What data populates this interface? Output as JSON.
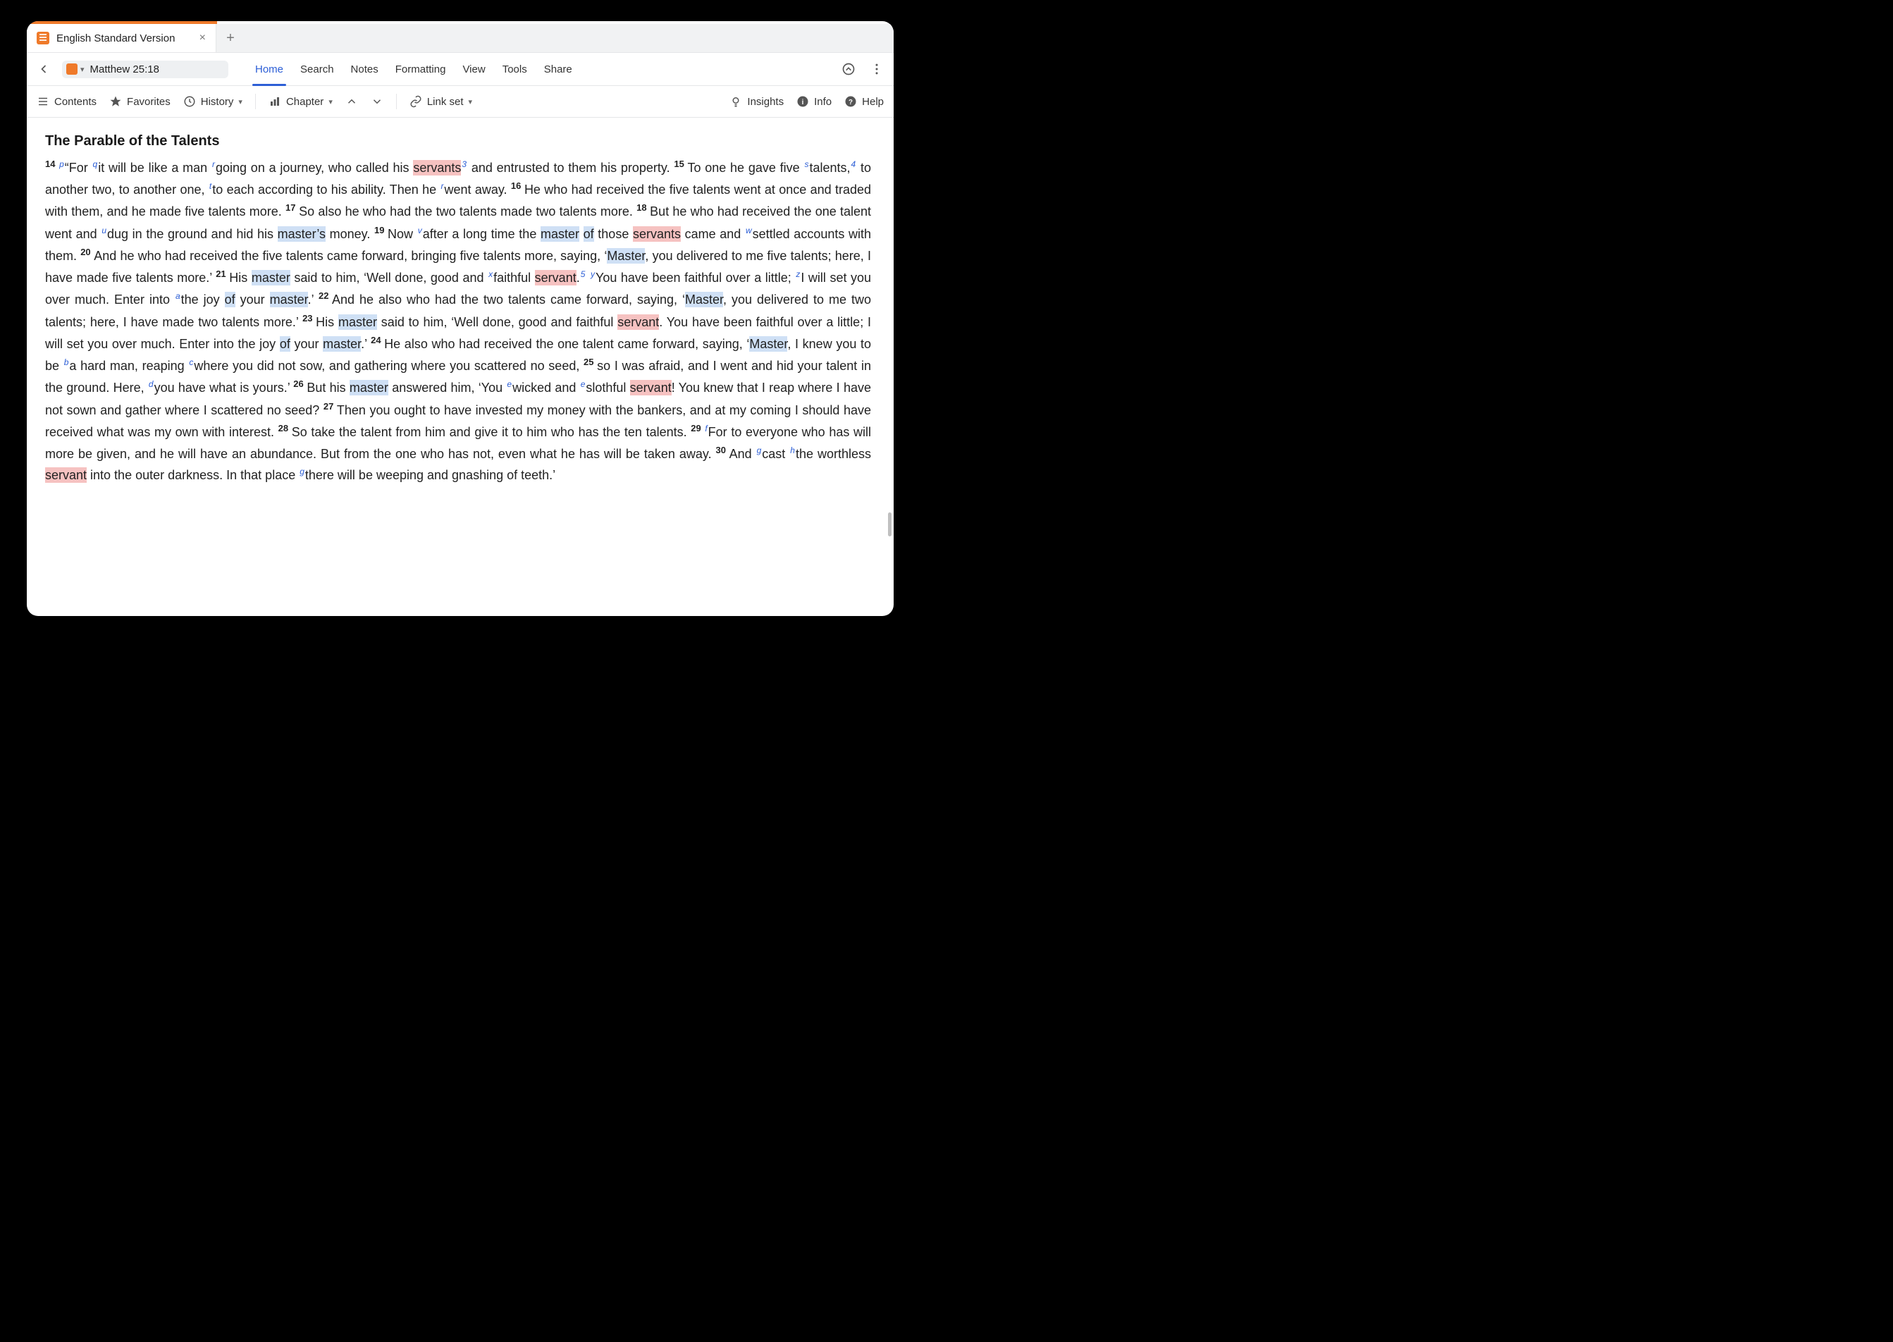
{
  "tab": {
    "title": "English Standard Version"
  },
  "location": {
    "reference": "Matthew 25:18"
  },
  "menu": {
    "home": "Home",
    "search": "Search",
    "notes": "Notes",
    "formatting": "Formatting",
    "view": "View",
    "tools": "Tools",
    "share": "Share"
  },
  "toolbar": {
    "contents": "Contents",
    "favorites": "Favorites",
    "history": "History",
    "chapter": "Chapter",
    "linkset": "Link set",
    "insights": "Insights",
    "info": "Info",
    "help": "Help"
  },
  "section_title": "The Parable of the Talents",
  "verses": [
    {
      "n": "14",
      "parts": [
        {
          "t": "xnote",
          "v": "p"
        },
        {
          "t": "text",
          "v": "“For "
        },
        {
          "t": "xnote",
          "v": "q"
        },
        {
          "t": "text",
          "v": "it will be like a man "
        },
        {
          "t": "xnote",
          "v": "r"
        },
        {
          "t": "text",
          "v": "going on a journey, who called his "
        },
        {
          "t": "hl-p",
          "v": "servants"
        },
        {
          "t": "fnote",
          "v": "3"
        },
        {
          "t": "text",
          "v": " and entrusted to them his property. "
        }
      ]
    },
    {
      "n": "15",
      "parts": [
        {
          "t": "text",
          "v": "To one he gave five "
        },
        {
          "t": "xnote",
          "v": "s"
        },
        {
          "t": "text",
          "v": "talents,"
        },
        {
          "t": "fnote",
          "v": "4"
        },
        {
          "t": "text",
          "v": " to another two, to another one, "
        },
        {
          "t": "xnote",
          "v": "t"
        },
        {
          "t": "text",
          "v": "to each according to his ability. Then he "
        },
        {
          "t": "xnote",
          "v": "r"
        },
        {
          "t": "text",
          "v": "went away. "
        }
      ]
    },
    {
      "n": "16",
      "parts": [
        {
          "t": "text",
          "v": "He who had received the five talents went at once and traded with them, and he made five talents more. "
        }
      ]
    },
    {
      "n": "17",
      "parts": [
        {
          "t": "text",
          "v": "So also he who had the two talents made two talents more. "
        }
      ]
    },
    {
      "n": "18",
      "parts": [
        {
          "t": "text",
          "v": "But he who had received the one talent went and "
        },
        {
          "t": "xnote",
          "v": "u"
        },
        {
          "t": "text",
          "v": "dug in the ground and hid his "
        },
        {
          "t": "hl-b",
          "v": "master’s"
        },
        {
          "t": "text",
          "v": " money. "
        }
      ]
    },
    {
      "n": "19",
      "parts": [
        {
          "t": "text",
          "v": "Now "
        },
        {
          "t": "xnote",
          "v": "v"
        },
        {
          "t": "text",
          "v": "after a long time the "
        },
        {
          "t": "hl-b",
          "v": "master"
        },
        {
          "t": "text",
          "v": " "
        },
        {
          "t": "hl-b",
          "v": "of"
        },
        {
          "t": "text",
          "v": " those "
        },
        {
          "t": "hl-p",
          "v": "servants"
        },
        {
          "t": "text",
          "v": " came and "
        },
        {
          "t": "xnote",
          "v": "w"
        },
        {
          "t": "text",
          "v": "settled accounts with them. "
        }
      ]
    },
    {
      "n": "20",
      "parts": [
        {
          "t": "text",
          "v": "And he who had received the five talents came forward, bringing five talents more, saying, ‘"
        },
        {
          "t": "hl-b",
          "v": "Master"
        },
        {
          "t": "text",
          "v": ", you delivered to me five talents; here, I have made five talents more.’ "
        }
      ]
    },
    {
      "n": "21",
      "parts": [
        {
          "t": "text",
          "v": "His "
        },
        {
          "t": "hl-b",
          "v": "master"
        },
        {
          "t": "text",
          "v": " said to him, ‘Well done, good and "
        },
        {
          "t": "xnote",
          "v": "x"
        },
        {
          "t": "text",
          "v": "faithful "
        },
        {
          "t": "hl-p",
          "v": "servant"
        },
        {
          "t": "text",
          "v": "."
        },
        {
          "t": "fnote",
          "v": "5"
        },
        {
          "t": "text",
          "v": " "
        },
        {
          "t": "xnote",
          "v": "y"
        },
        {
          "t": "text",
          "v": "You have been faithful over a little; "
        },
        {
          "t": "xnote",
          "v": "z"
        },
        {
          "t": "text",
          "v": "I will set you over much. Enter into "
        },
        {
          "t": "xnote",
          "v": "a"
        },
        {
          "t": "text",
          "v": "the joy "
        },
        {
          "t": "hl-b",
          "v": "of"
        },
        {
          "t": "text",
          "v": " your "
        },
        {
          "t": "hl-b",
          "v": "master"
        },
        {
          "t": "text",
          "v": ".’ "
        }
      ]
    },
    {
      "n": "22",
      "parts": [
        {
          "t": "text",
          "v": "And he also who had the two talents came forward, saying, ‘"
        },
        {
          "t": "hl-b",
          "v": "Master"
        },
        {
          "t": "text",
          "v": ", you delivered to me two talents; here, I have made two talents more.’ "
        }
      ]
    },
    {
      "n": "23",
      "parts": [
        {
          "t": "text",
          "v": "His "
        },
        {
          "t": "hl-b",
          "v": "master"
        },
        {
          "t": "text",
          "v": " said to him, ‘Well done, good and faithful "
        },
        {
          "t": "hl-p",
          "v": "servant"
        },
        {
          "t": "text",
          "v": ". You have been faithful over a little; I will set you over much. Enter into the joy "
        },
        {
          "t": "hl-b",
          "v": "of"
        },
        {
          "t": "text",
          "v": " your "
        },
        {
          "t": "hl-b",
          "v": "master"
        },
        {
          "t": "text",
          "v": ".’ "
        }
      ]
    },
    {
      "n": "24",
      "parts": [
        {
          "t": "text",
          "v": "He also who had received the one talent came forward, saying, ‘"
        },
        {
          "t": "hl-b",
          "v": "Master"
        },
        {
          "t": "text",
          "v": ", I knew you to be "
        },
        {
          "t": "xnote",
          "v": "b"
        },
        {
          "t": "text",
          "v": "a hard man, reaping "
        },
        {
          "t": "xnote",
          "v": "c"
        },
        {
          "t": "text",
          "v": "where you did not sow, and gathering where you scattered no seed, "
        }
      ]
    },
    {
      "n": "25",
      "parts": [
        {
          "t": "text",
          "v": "so I was afraid, and I went and hid your talent in the ground. Here, "
        },
        {
          "t": "xnote",
          "v": "d"
        },
        {
          "t": "text",
          "v": "you have what is yours.’ "
        }
      ]
    },
    {
      "n": "26",
      "parts": [
        {
          "t": "text",
          "v": "But his "
        },
        {
          "t": "hl-b",
          "v": "master"
        },
        {
          "t": "text",
          "v": " answered him, ‘You "
        },
        {
          "t": "xnote",
          "v": "e"
        },
        {
          "t": "text",
          "v": "wicked and "
        },
        {
          "t": "xnote",
          "v": "e"
        },
        {
          "t": "text",
          "v": "slothful "
        },
        {
          "t": "hl-p",
          "v": "servant"
        },
        {
          "t": "text",
          "v": "! You knew that I reap where I have not sown and gather where I scattered no seed? "
        }
      ]
    },
    {
      "n": "27",
      "parts": [
        {
          "t": "text",
          "v": "Then you ought to have invested my money with the bankers, and at my coming I should have received what was my own with interest. "
        }
      ]
    },
    {
      "n": "28",
      "parts": [
        {
          "t": "text",
          "v": "So take the talent from him and give it to him who has the ten talents. "
        }
      ]
    },
    {
      "n": "29",
      "parts": [
        {
          "t": "xnote",
          "v": "f"
        },
        {
          "t": "text",
          "v": "For to everyone who has will more be given, and he will have an abundance. But from the one who has not, even what he has will be taken away. "
        }
      ]
    },
    {
      "n": "30",
      "parts": [
        {
          "t": "text",
          "v": "And "
        },
        {
          "t": "xnote",
          "v": "g"
        },
        {
          "t": "text",
          "v": "cast "
        },
        {
          "t": "xnote",
          "v": "h"
        },
        {
          "t": "text",
          "v": "the worthless "
        },
        {
          "t": "hl-p",
          "v": "servant"
        },
        {
          "t": "text",
          "v": " into the outer darkness. In that place "
        },
        {
          "t": "xnote",
          "v": "g"
        },
        {
          "t": "text",
          "v": "there will be weeping and gnashing of teeth.’"
        }
      ]
    }
  ]
}
